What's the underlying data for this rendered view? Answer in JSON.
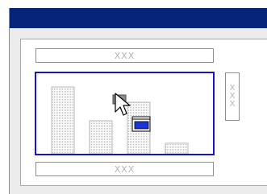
{
  "window": {
    "title": ""
  },
  "fields": {
    "top": "XXX",
    "bottom": "XXX",
    "side": [
      "X",
      "X",
      "X"
    ]
  },
  "chart_data": {
    "type": "bar",
    "categories": [
      "",
      "",
      "",
      ""
    ],
    "values": [
      90,
      45,
      70,
      14
    ],
    "ylim": [
      0,
      100
    ],
    "title": "",
    "xlabel": "",
    "ylabel": "",
    "grid": false
  },
  "colors": {
    "titlebar": "#06257a",
    "selection_border": "#1414ce",
    "bar_fill": "#e9e9e9",
    "bar_outline": "#b8b8b8"
  },
  "icons": {
    "cursor": "arrow-cursor-with-drag-icon"
  }
}
